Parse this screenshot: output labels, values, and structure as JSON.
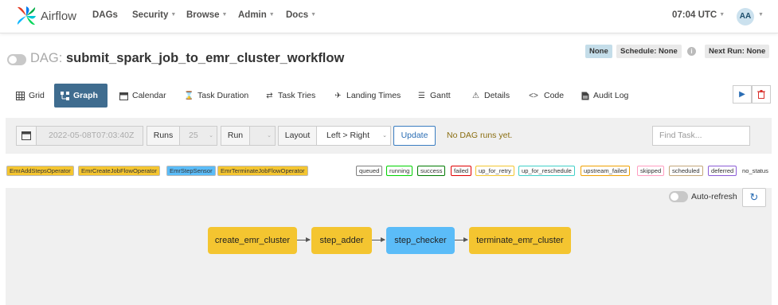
{
  "app": {
    "name": "Airflow"
  },
  "nav": {
    "items": [
      {
        "label": "DAGs",
        "caret": false
      },
      {
        "label": "Security",
        "caret": true
      },
      {
        "label": "Browse",
        "caret": true
      },
      {
        "label": "Admin",
        "caret": true
      },
      {
        "label": "Docs",
        "caret": true
      }
    ],
    "clock": "07:04 UTC",
    "user_initials": "AA"
  },
  "dag": {
    "label": "DAG:",
    "id": "submit_spark_job_to_emr_cluster_workflow",
    "badges": {
      "none": "None",
      "schedule": "Schedule: None",
      "next_run": "Next Run: None"
    }
  },
  "tabs": [
    {
      "label": "Grid",
      "icon": "grid-icon",
      "active": false
    },
    {
      "label": "Graph",
      "icon": "graph-icon",
      "active": true
    },
    {
      "label": "Calendar",
      "icon": "calendar-icon",
      "active": false
    },
    {
      "label": "Task Duration",
      "icon": "hourglass-icon",
      "active": false
    },
    {
      "label": "Task Tries",
      "icon": "retry-icon",
      "active": false
    },
    {
      "label": "Landing Times",
      "icon": "plane-icon",
      "active": false
    },
    {
      "label": "Gantt",
      "icon": "gantt-icon",
      "active": false
    },
    {
      "label": "Details",
      "icon": "warning-icon",
      "active": false
    },
    {
      "label": "Code",
      "icon": "code-icon",
      "active": false
    },
    {
      "label": "Audit Log",
      "icon": "file-icon",
      "active": false
    }
  ],
  "filters": {
    "base_date": "2022-05-08T07:03:40Z",
    "runs_label": "Runs",
    "runs_value": "25",
    "run_label": "Run",
    "layout_label": "Layout",
    "layout_value": "Left > Right",
    "update_label": "Update",
    "no_runs_text": "No DAG runs yet.",
    "find_placeholder": "Find Task..."
  },
  "operators": [
    {
      "label": "EmrAddStepsOperator",
      "color": "#f4c530"
    },
    {
      "label": "EmrCreateJobFlowOperator",
      "color": "#f4c530"
    },
    {
      "label": "EmrStepSensor",
      "color": "#5bbcf8"
    },
    {
      "label": "EmrTerminateJobFlowOperator",
      "color": "#f4c530"
    }
  ],
  "states": [
    {
      "label": "queued",
      "color": "#808080"
    },
    {
      "label": "running",
      "color": "#00d300"
    },
    {
      "label": "success",
      "color": "#007a00"
    },
    {
      "label": "failed",
      "color": "#e00000"
    },
    {
      "label": "up_for_retry",
      "color": "#f2c630"
    },
    {
      "label": "up_for_reschedule",
      "color": "#40d0c8"
    },
    {
      "label": "upstream_failed",
      "color": "#f0a000"
    },
    {
      "label": "skipped",
      "color": "#ff9dc0"
    },
    {
      "label": "scheduled",
      "color": "#c4a77a"
    },
    {
      "label": "deferred",
      "color": "#8b5bd6"
    },
    {
      "label": "no_status",
      "color": ""
    }
  ],
  "graph": {
    "auto_refresh_label": "Auto-refresh",
    "nodes": [
      {
        "label": "create_emr_cluster",
        "color": "#f4c530"
      },
      {
        "label": "step_adder",
        "color": "#f4c530"
      },
      {
        "label": "step_checker",
        "color": "#5bbcf8"
      },
      {
        "label": "terminate_emr_cluster",
        "color": "#f4c530"
      }
    ]
  }
}
